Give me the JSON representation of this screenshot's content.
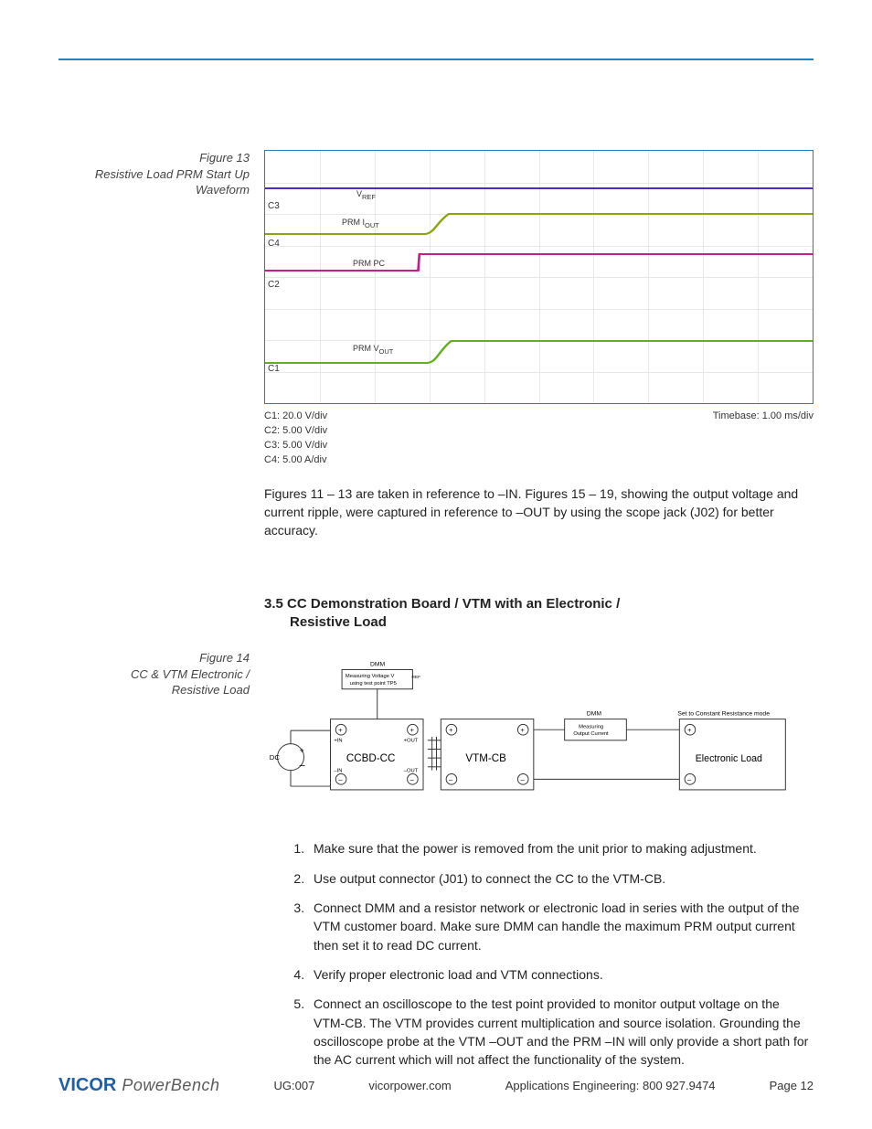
{
  "figure13": {
    "caption_line1": "Figure 13",
    "caption_line2": "Resistive Load PRM Start Up",
    "caption_line3": "Waveform",
    "traces": {
      "c3_label": "C3",
      "c3_name": "VREF",
      "c4_label": "C4",
      "c4_name": "PRM IOUT",
      "c2_label": "C2",
      "c2_name": "PRM PC",
      "c1_label": "C1",
      "c1_name": "PRM VOUT"
    },
    "scales": {
      "c1": "C1: 20.0 V/div",
      "c2": "C2: 5.00 V/div",
      "c3": "C3: 5.00 V/div",
      "c4": "C4: 5.00 A/div",
      "timebase": "Timebase: 1.00 ms/div"
    }
  },
  "paragraph_after_fig13": "Figures 11 – 13 are taken in reference to –IN. Figures 15 – 19, showing the output voltage and current ripple, were captured in reference to –OUT by using the scope jack (J02) for better accuracy.",
  "section_heading": {
    "number": "3.5",
    "line1": "CC Demonstration Board / VTM with an Electronic /",
    "line2": "Resistive Load"
  },
  "figure14": {
    "caption_line1": "Figure 14",
    "caption_line2": "CC & VTM Electronic /",
    "caption_line3": "Resistive Load",
    "labels": {
      "dmm1_title": "DMM",
      "dmm1_box_l1": "Measuring Voltage VREF",
      "dmm1_box_l2": "using test point TP5",
      "dmm2_title": "DMM",
      "dmm2_box_l1": "Measuring",
      "dmm2_box_l2": "Output Current",
      "mode_note": "Set to Constant Resistance mode",
      "dc": "DC",
      "plus_in": "+IN",
      "plus_out": "+OUT",
      "minus_in": "–IN",
      "minus_out": "–OUT",
      "ccbd": "CCBD-CC",
      "vtm": "VTM-CB",
      "eload": "Electronic Load"
    }
  },
  "steps": [
    "Make sure that the power is removed from the unit prior to making adjustment.",
    "Use output connector (J01) to connect the CC to the VTM-CB.",
    "Connect DMM and a resistor network or electronic load in series with the output of the VTM customer board. Make sure DMM can handle the maximum PRM output current then set it to read DC current.",
    "Verify proper electronic load and VTM connections.",
    "Connect an oscilloscope to the test point provided to monitor output voltage on the VTM-CB. The VTM provides current multiplication and source isolation. Grounding the oscilloscope probe at the VTM –OUT and the PRM –IN will only provide a short path for the AC current which will not affect the functionality of the system."
  ],
  "footer": {
    "logo1": "VICOR",
    "logo2": "PowerBench",
    "doc_code": "UG:007",
    "site": "vicorpower.com",
    "contact": "Applications Engineering: 800 927.9474",
    "page_label": "Page 12"
  }
}
